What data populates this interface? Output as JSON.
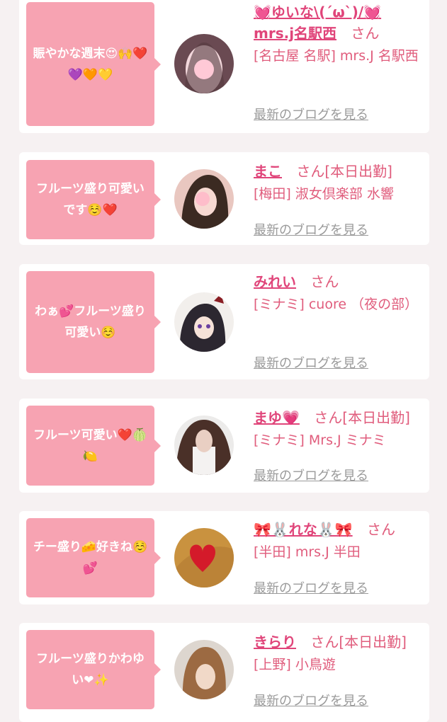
{
  "posts": [
    {
      "comment": "賑やかな週末😍🙌❤️💜🧡💛",
      "name": "💓ゆいな\\(´ω`)/💓mrs.j名駅西",
      "suffix": "さん",
      "shop": "[名古屋 名駅] mrs.J 名駅西",
      "blog_link": "最新のブログを見る",
      "avatar_colors": [
        "#6a4a52",
        "#f3d8dc"
      ]
    },
    {
      "comment": "フルーツ盛り可愛いです☺️❤️",
      "name": "まこ",
      "suffix": "さん[本日出勤]",
      "shop": "[梅田] 淑女倶楽部 水響",
      "blog_link": "最新のブログを見る",
      "avatar_colors": [
        "#3b2a22",
        "#e9c7c0"
      ]
    },
    {
      "comment": "わぁ💕フルーツ盛り可愛い☺️",
      "name": "みれい",
      "suffix": "さん",
      "shop": "[ミナミ] cuore （夜の部）",
      "blog_link": "最新のブログを見る",
      "avatar_colors": [
        "#2c2730",
        "#f2efec"
      ]
    },
    {
      "comment": "フルーツ可愛い❤️🍈🍋",
      "name": "まゆ💗",
      "suffix": "さん[本日出勤]",
      "shop": "[ミナミ] Mrs.J ミナミ",
      "blog_link": "最新のブログを見る",
      "avatar_colors": [
        "#4a3028",
        "#ecebea"
      ]
    },
    {
      "comment": "チー盛り🧀好きね☺️💕",
      "name": "🎀🐰れな🐰🎀",
      "suffix": "さん",
      "shop": "[半田] mrs.J 半田",
      "blog_link": "最新のブログを見る",
      "avatar_colors": [
        "#c9923f",
        "#d41a2a"
      ]
    },
    {
      "comment": "フルーツ盛りかわゆい❤✨",
      "name": "きらり",
      "suffix": "さん[本日出勤]",
      "shop": "[上野] 小鳥遊",
      "blog_link": "最新のブログを見る",
      "avatar_colors": [
        "#9c6a42",
        "#ddd6cf"
      ]
    }
  ]
}
